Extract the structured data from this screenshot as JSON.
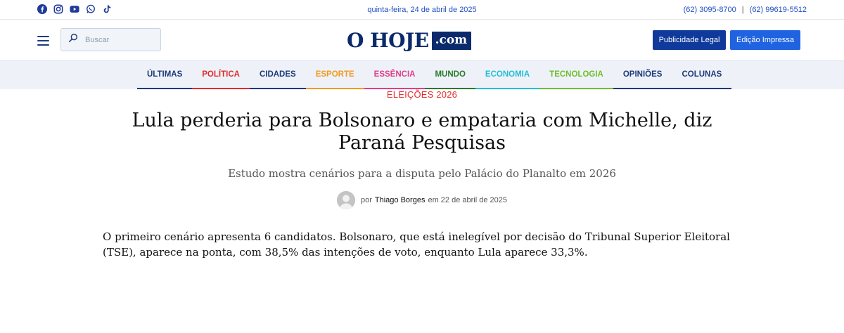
{
  "topbar": {
    "social_icons": [
      "facebook-icon",
      "instagram-icon",
      "youtube-icon",
      "whatsapp-icon",
      "tiktok-icon"
    ],
    "date": "quinta-feira, 24 de abril de 2025",
    "phone_1": "(62) 3095-8700",
    "phone_sep": "|",
    "phone_2": "(62) 99619-5512"
  },
  "header": {
    "search_placeholder": "Buscar",
    "logo_main": "O HOJE",
    "logo_suffix": ".com",
    "btn_publicidade": "Publicidade Legal",
    "btn_edicao": "Edição Impressa"
  },
  "nav": {
    "items": [
      {
        "label": "ÚLTIMAS",
        "color": "#1f3a7a"
      },
      {
        "label": "POLÍTICA",
        "color": "#e02b2b"
      },
      {
        "label": "CIDADES",
        "color": "#1f3a7a"
      },
      {
        "label": "ESPORTE",
        "color": "#f39a1e"
      },
      {
        "label": "ESSÊNCIA",
        "color": "#e23d8a"
      },
      {
        "label": "MUNDO",
        "color": "#2c7a2c"
      },
      {
        "label": "ECONOMIA",
        "color": "#21bfd6"
      },
      {
        "label": "TECNOLOGIA",
        "color": "#6fbf2a"
      },
      {
        "label": "OPINIÕES",
        "color": "#1f3a7a"
      },
      {
        "label": "COLUNAS",
        "color": "#1f3a7a"
      }
    ]
  },
  "article": {
    "kicker": "ELEIÇÕES 2026",
    "title": "Lula perderia para Bolsonaro e empataria com Michelle, diz Paraná Pesquisas",
    "subtitle": "Estudo mostra cenários para a disputa pelo Palácio do Planalto em 2026",
    "by": "por",
    "author": "Thiago Borges",
    "date_prefix": "em 22 de abril de 2025",
    "body": "O primeiro cenário apresenta 6 candidatos. Bolsonaro, que está inelegível por decisão do Tribunal Superior Eleitoral (TSE), aparece na ponta, com 38,5% das intenções de voto, enquanto Lula aparece 33,3%."
  },
  "colors": {
    "brand": "#0b2a6b",
    "accent_blue": "#1f4fbf",
    "kicker_red": "#e52b2b"
  }
}
